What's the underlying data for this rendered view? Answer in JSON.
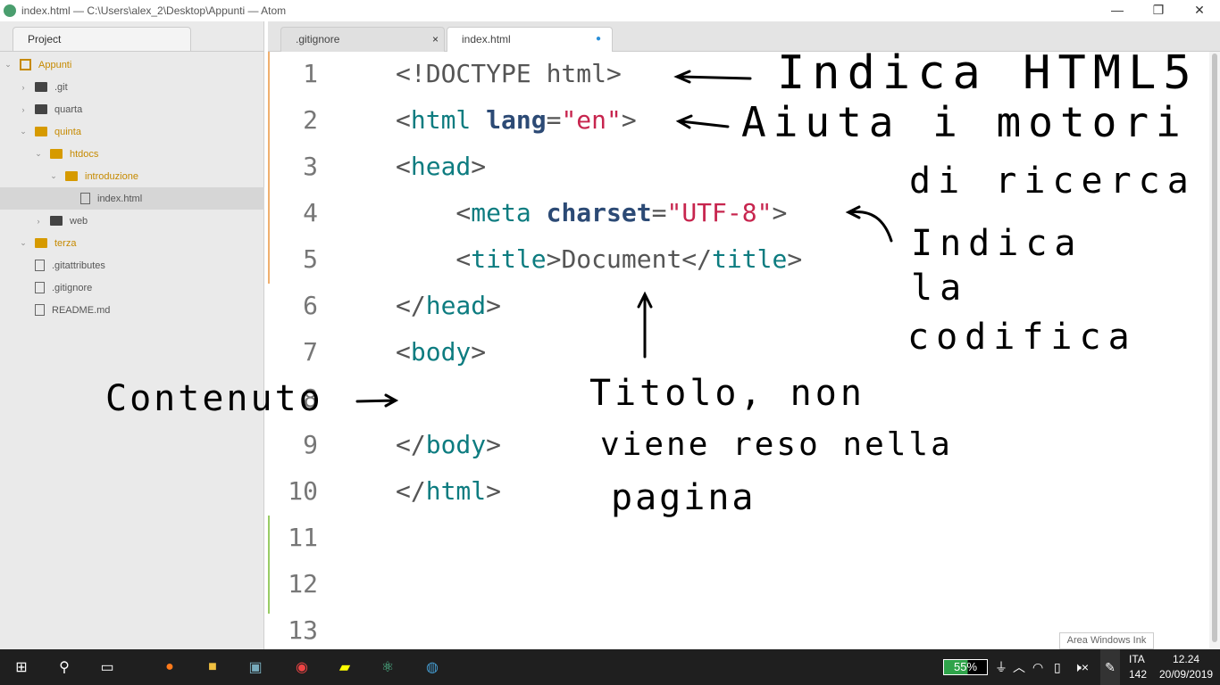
{
  "window": {
    "title": "index.html — C:\\Users\\alex_2\\Desktop\\Appunti — Atom",
    "minimize": "—",
    "maximize": "❐",
    "close": "✕"
  },
  "sidebar": {
    "tab": "Project",
    "items": [
      {
        "label": "Appunti",
        "type": "repo",
        "depth": 0,
        "open": true
      },
      {
        "label": ".git",
        "type": "folder",
        "depth": 1
      },
      {
        "label": "quarta",
        "type": "folder",
        "depth": 1
      },
      {
        "label": "quinta",
        "type": "folder",
        "depth": 1,
        "open": true
      },
      {
        "label": "htdocs",
        "type": "folder",
        "depth": 2,
        "open": true
      },
      {
        "label": "introduzione",
        "type": "folder",
        "depth": 3,
        "open": true
      },
      {
        "label": "index.html",
        "type": "file",
        "depth": 4,
        "selected": true
      },
      {
        "label": "web",
        "type": "folder",
        "depth": 2
      },
      {
        "label": "terza",
        "type": "folder",
        "depth": 1,
        "open": true
      },
      {
        "label": ".gitattributes",
        "type": "file",
        "depth": 1
      },
      {
        "label": ".gitignore",
        "type": "file",
        "depth": 1
      },
      {
        "label": "README.md",
        "type": "file",
        "depth": 1
      }
    ]
  },
  "tabs": [
    {
      "label": ".gitignore",
      "close": "×"
    },
    {
      "label": "index.html",
      "modified": "●"
    }
  ],
  "editor": {
    "lines": [
      [
        [
          "p",
          "<!DOCTYPE html>"
        ]
      ],
      [
        [
          "p",
          "<"
        ],
        [
          "t",
          "html"
        ],
        [
          "p",
          " "
        ],
        [
          "a",
          "lang"
        ],
        [
          "p",
          "="
        ],
        [
          "s",
          "\"en\""
        ],
        [
          "p",
          ">"
        ]
      ],
      [
        [
          "p",
          "<"
        ],
        [
          "t",
          "head"
        ],
        [
          "p",
          ">"
        ]
      ],
      [
        [
          "p",
          "    <"
        ],
        [
          "t",
          "meta"
        ],
        [
          "p",
          " "
        ],
        [
          "a",
          "charset"
        ],
        [
          "p",
          "="
        ],
        [
          "s",
          "\"UTF-8\""
        ],
        [
          "p",
          ">"
        ]
      ],
      [
        [
          "p",
          "    <"
        ],
        [
          "t",
          "title"
        ],
        [
          "p",
          ">Document</"
        ],
        [
          "t",
          "title"
        ],
        [
          "p",
          ">"
        ]
      ],
      [
        [
          "p",
          "</"
        ],
        [
          "t",
          "head"
        ],
        [
          "p",
          ">"
        ]
      ],
      [
        [
          "p",
          "<"
        ],
        [
          "t",
          "body"
        ],
        [
          "p",
          ">"
        ]
      ],
      [],
      [
        [
          "p",
          "</"
        ],
        [
          "t",
          "body"
        ],
        [
          "p",
          ">"
        ]
      ],
      [
        [
          "p",
          "</"
        ],
        [
          "t",
          "html"
        ],
        [
          "p",
          ">"
        ]
      ],
      [],
      [],
      []
    ]
  },
  "annotations": {
    "html5": "Indica HTML5",
    "motori1": "Aiuta i motori",
    "motori2": "di ricerca",
    "cod1": "Indica",
    "cod2": "la",
    "cod3": "codifica",
    "contenuto": "Contenuto",
    "titolo1": "Titolo, non",
    "titolo2": "viene reso nella",
    "titolo3": "pagina"
  },
  "tooltip": "Area Windows Ink",
  "taskbar": {
    "battery": "55%",
    "lang": "ITA",
    "lang2": "142",
    "time": "12.24",
    "date": "20/09/2019"
  }
}
